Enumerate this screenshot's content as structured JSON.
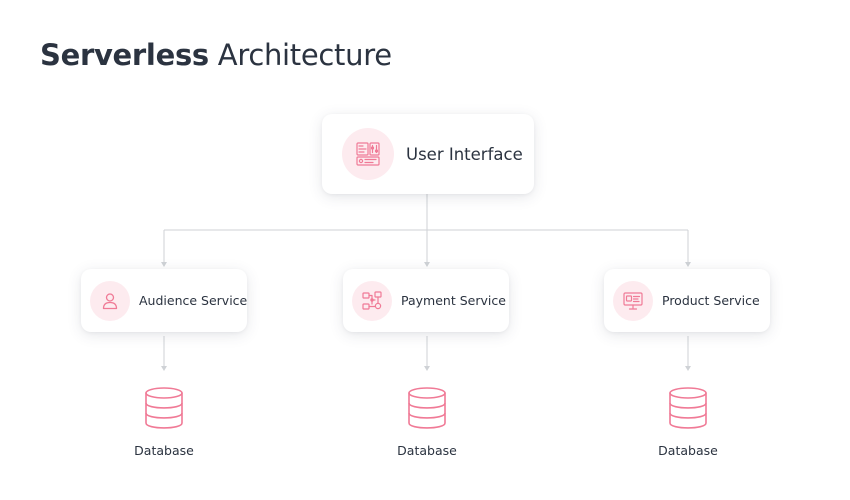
{
  "title": {
    "bold": "Serverless",
    "regular": " Architecture"
  },
  "nodes": {
    "user_interface": {
      "label": "User Interface",
      "icon": "dashboard-icon"
    },
    "services": [
      {
        "label": "Audience Service",
        "icon": "user-icon"
      },
      {
        "label": "Payment Service",
        "icon": "payment-flow-icon"
      },
      {
        "label": "Product Service",
        "icon": "monitor-icon"
      }
    ],
    "databases": [
      {
        "label": "Database",
        "icon": "database-icon"
      },
      {
        "label": "Database",
        "icon": "database-icon"
      },
      {
        "label": "Database",
        "icon": "database-icon"
      }
    ]
  },
  "edges": [
    {
      "from": "User Interface",
      "to": "Audience Service"
    },
    {
      "from": "User Interface",
      "to": "Payment Service"
    },
    {
      "from": "User Interface",
      "to": "Product Service"
    },
    {
      "from": "Audience Service",
      "to": "Database"
    },
    {
      "from": "Payment Service",
      "to": "Database"
    },
    {
      "from": "Product Service",
      "to": "Database"
    }
  ],
  "colors": {
    "accent": "#f07a96",
    "accent_bg": "#fdebef",
    "connector": "#cfd2d6",
    "text": "#2b3340"
  }
}
